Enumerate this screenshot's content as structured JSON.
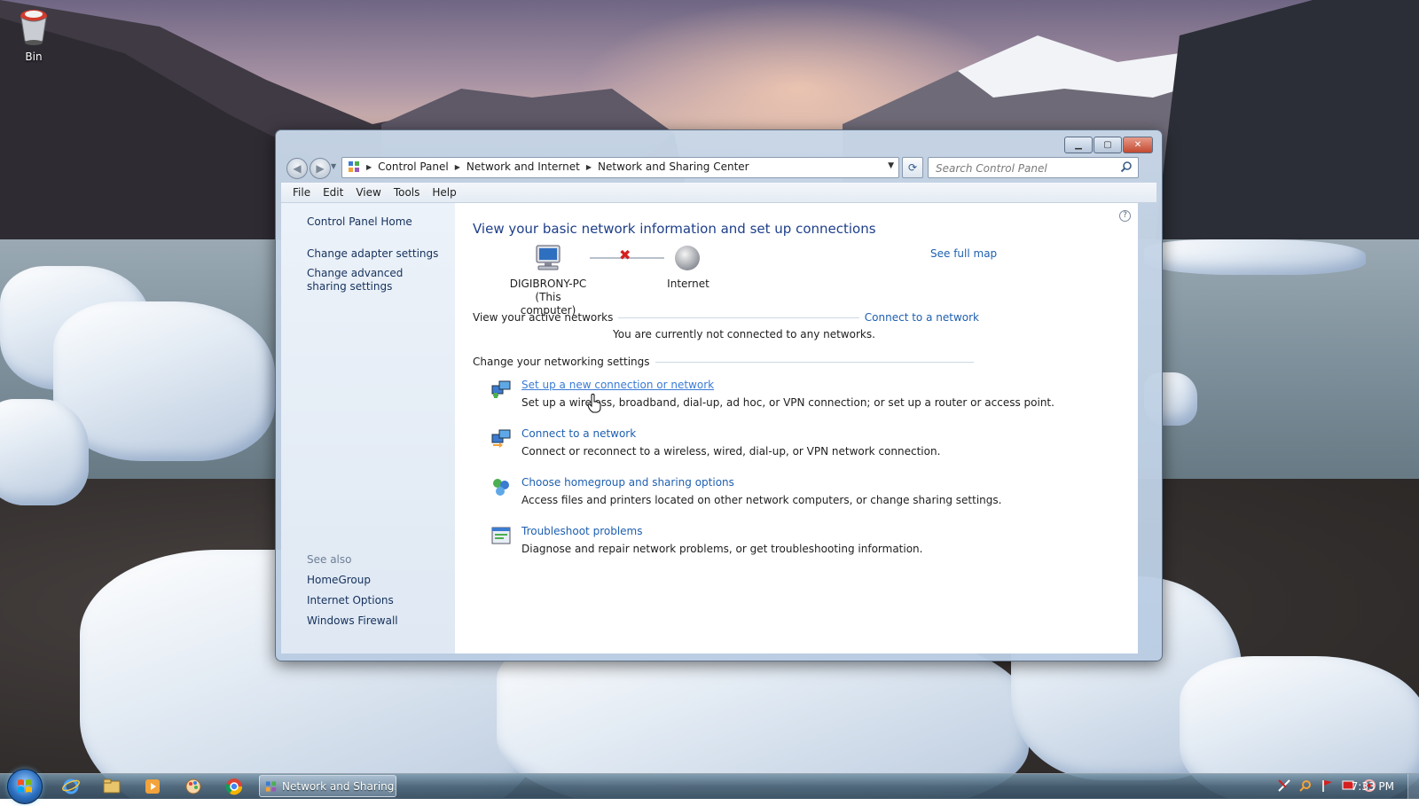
{
  "desktop": {
    "icons": [
      {
        "label": "Bin",
        "icon": "recycle-bin-icon"
      }
    ]
  },
  "window": {
    "breadcrumb": [
      "Control Panel",
      "Network and Internet",
      "Network and Sharing Center"
    ],
    "search_placeholder": "Search Control Panel",
    "menu": [
      "File",
      "Edit",
      "View",
      "Tools",
      "Help"
    ],
    "sidebar": {
      "home": "Control Panel Home",
      "links": [
        "Change adapter settings",
        "Change advanced sharing settings"
      ],
      "see_also_title": "See also",
      "see_also": [
        "HomeGroup",
        "Internet Options",
        "Windows Firewall"
      ]
    },
    "main": {
      "title": "View your basic network information and set up connections",
      "see_full_map": "See full map",
      "map": {
        "computer_name": "DIGIBRONY-PC",
        "computer_sub": "(This computer)",
        "internet": "Internet"
      },
      "active_networks": {
        "title": "View your active networks",
        "link": "Connect to a network",
        "status": "You are currently not connected to any networks."
      },
      "settings": {
        "title": "Change your networking settings",
        "tasks": [
          {
            "link": "Set up a new connection or network",
            "desc": "Set up a wireless, broadband, dial-up, ad hoc, or VPN connection; or set up a router or access point.",
            "icon": "new-connection-icon"
          },
          {
            "link": "Connect to a network",
            "desc": "Connect or reconnect to a wireless, wired, dial-up, or VPN network connection.",
            "icon": "connect-network-icon"
          },
          {
            "link": "Choose homegroup and sharing options",
            "desc": "Access files and printers located on other network computers, or change sharing settings.",
            "icon": "homegroup-icon"
          },
          {
            "link": "Troubleshoot problems",
            "desc": "Diagnose and repair network problems, or get troubleshooting information.",
            "icon": "troubleshoot-icon"
          }
        ]
      }
    }
  },
  "taskbar": {
    "pinned": [
      "internet-explorer-icon",
      "explorer-folder-icon",
      "media-player-icon",
      "paint-icon",
      "chrome-icon"
    ],
    "active_task": "Network and Sharing...",
    "clock": "7:33 PM"
  }
}
